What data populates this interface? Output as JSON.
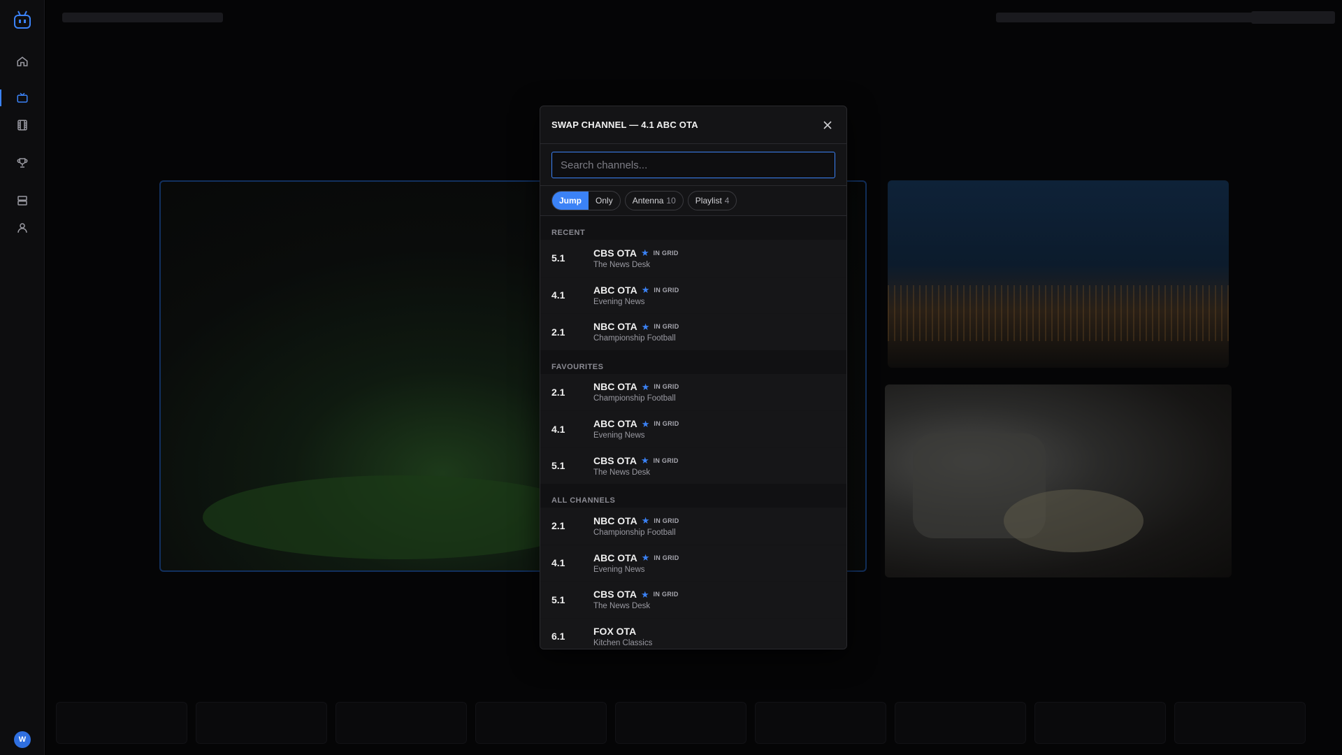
{
  "modal": {
    "title": "SWAP CHANNEL — 4.1 ABC OTA",
    "search_placeholder": "Search channels...",
    "filters": {
      "jump": "Jump",
      "only": "Only",
      "antenna": {
        "label": "Antenna",
        "count": "10"
      },
      "playlist": {
        "label": "Playlist",
        "count": "4"
      }
    },
    "sections": {
      "recent": {
        "label": "RECENT",
        "items": [
          {
            "num": "5.1",
            "name": "CBS OTA",
            "badge": "IN GRID",
            "sub": "The News Desk"
          },
          {
            "num": "4.1",
            "name": "ABC OTA",
            "badge": "IN GRID",
            "sub": "Evening News"
          },
          {
            "num": "2.1",
            "name": "NBC OTA",
            "badge": "IN GRID",
            "sub": "Championship Football"
          }
        ]
      },
      "favourites": {
        "label": "FAVOURITES",
        "items": [
          {
            "num": "2.1",
            "name": "NBC OTA",
            "badge": "IN GRID",
            "sub": "Championship Football"
          },
          {
            "num": "4.1",
            "name": "ABC OTA",
            "badge": "IN GRID",
            "sub": "Evening News"
          },
          {
            "num": "5.1",
            "name": "CBS OTA",
            "badge": "IN GRID",
            "sub": "The News Desk"
          }
        ]
      },
      "all": {
        "label": "ALL CHANNELS",
        "items": [
          {
            "num": "2.1",
            "name": "NBC OTA",
            "badge": "IN GRID",
            "sub": "Championship Football"
          },
          {
            "num": "4.1",
            "name": "ABC OTA",
            "badge": "IN GRID",
            "sub": "Evening News"
          },
          {
            "num": "5.1",
            "name": "CBS OTA",
            "badge": "IN GRID",
            "sub": "The News Desk"
          },
          {
            "num": "6.1",
            "name": "FOX OTA",
            "sub": "Kitchen Classics"
          }
        ]
      }
    }
  },
  "sidebar": {
    "avatar_initial": "W",
    "icons": [
      "home-icon",
      "tv-icon",
      "film-icon",
      "trophy-icon",
      "layout-icon",
      "user-icon"
    ]
  },
  "colors": {
    "accent": "#3b82f6",
    "modal_bg": "#141416"
  }
}
